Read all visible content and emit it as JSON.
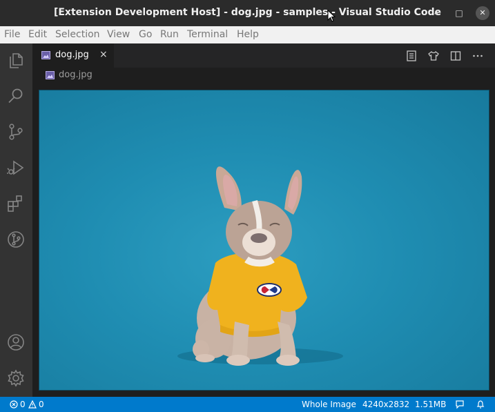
{
  "window": {
    "title": "[Extension Development Host] - dog.jpg - samples - Visual Studio Code",
    "minimize_icon": "–",
    "maximize_icon": "□",
    "close_icon": "✕"
  },
  "menu": {
    "items": [
      "File",
      "Edit",
      "Selection",
      "View",
      "Go",
      "Run",
      "Terminal",
      "Help"
    ]
  },
  "activity_bar": {
    "icons": [
      "explorer-icon",
      "search-icon",
      "source-control-icon",
      "run-debug-icon",
      "extensions-icon",
      "git-graph-icon",
      "account-icon",
      "manage-gear-icon"
    ]
  },
  "tabs": [
    {
      "label": "dog.jpg",
      "icon": "image-file-icon",
      "close": "×"
    }
  ],
  "tab_actions": [
    "open-preview-icon",
    "shirt-icon",
    "split-editor-icon",
    "more-actions-icon"
  ],
  "breadcrumb": {
    "label": "dog.jpg",
    "icon": "image-file-icon"
  },
  "status_bar": {
    "errors": "0",
    "warnings": "0",
    "zoom": "Whole Image",
    "dimensions": "4240x2832",
    "size": "1.51MB"
  },
  "colors": {
    "accent": "#007acc",
    "background": "#1e1e1e",
    "shirt": "#f0b21e"
  }
}
